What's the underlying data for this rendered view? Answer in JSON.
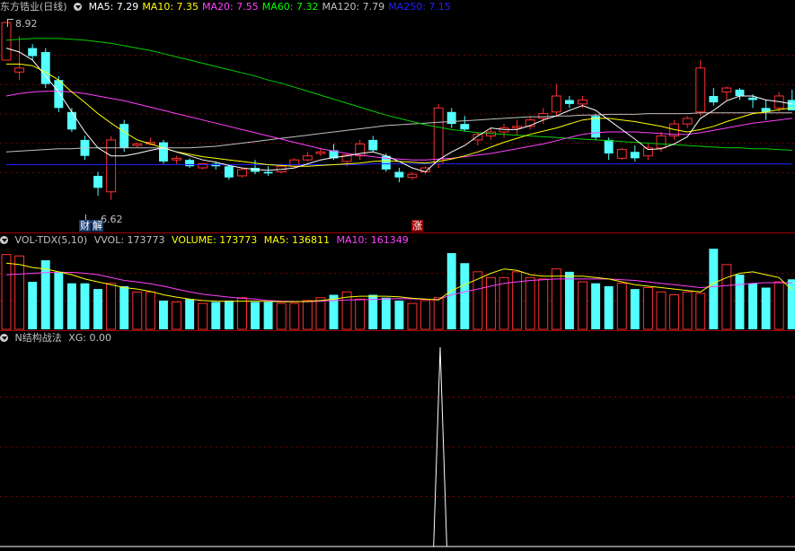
{
  "main": {
    "title": "东方锆业(日线)",
    "ma": [
      {
        "label": "MA5: 7.29",
        "color": "#ffffff"
      },
      {
        "label": "MA10: 7.35",
        "color": "#ffff00"
      },
      {
        "label": "MA20: 7.55",
        "color": "#ff40ff"
      },
      {
        "label": "MA60: 7.32",
        "color": "#00ff00"
      },
      {
        "label": "MA120: 7.79",
        "color": "#c0c0c0"
      },
      {
        "label": "MA250: 7.15",
        "color": "#2020ff"
      }
    ],
    "high_label": "8.92",
    "low_label": "6.62",
    "tag_finance": "财",
    "tag_explain": "解",
    "tag_limitup": "涨"
  },
  "volume": {
    "title": "VOL-TDX(5,10)",
    "vvol": "VVOL: 173773",
    "volume": "VOLUME: 173773",
    "ma5": "MA5: 136811",
    "ma10": "MA10: 161349"
  },
  "indicator": {
    "title": "N结构战法",
    "xg": "XG: 0.00"
  },
  "colors": {
    "up": "#ff3030",
    "down": "#54ffff",
    "grid": "#800000"
  },
  "chart_data": {
    "type": "candlestick",
    "ohlc": [
      [
        8.45,
        8.92,
        8.45,
        8.92
      ],
      [
        8.3,
        8.75,
        8.2,
        8.35
      ],
      [
        8.6,
        8.65,
        8.45,
        8.5
      ],
      [
        8.55,
        8.6,
        8.1,
        8.15
      ],
      [
        8.2,
        8.25,
        7.8,
        7.85
      ],
      [
        7.8,
        7.85,
        7.55,
        7.58
      ],
      [
        7.45,
        7.5,
        7.2,
        7.25
      ],
      [
        7.0,
        7.05,
        6.75,
        6.85
      ],
      [
        6.8,
        7.5,
        6.7,
        7.45
      ],
      [
        7.65,
        7.7,
        7.3,
        7.35
      ],
      [
        7.38,
        7.42,
        7.36,
        7.4
      ],
      [
        7.4,
        7.48,
        7.38,
        7.42
      ],
      [
        7.42,
        7.45,
        7.15,
        7.18
      ],
      [
        7.2,
        7.25,
        7.15,
        7.22
      ],
      [
        7.2,
        7.22,
        7.1,
        7.12
      ],
      [
        7.1,
        7.16,
        7.08,
        7.15
      ],
      [
        7.15,
        7.18,
        7.08,
        7.12
      ],
      [
        7.12,
        7.15,
        6.95,
        6.98
      ],
      [
        7.0,
        7.1,
        6.98,
        7.08
      ],
      [
        7.1,
        7.2,
        7.02,
        7.05
      ],
      [
        7.05,
        7.12,
        7.0,
        7.03
      ],
      [
        7.05,
        7.15,
        7.03,
        7.12
      ],
      [
        7.12,
        7.22,
        7.1,
        7.2
      ],
      [
        7.2,
        7.3,
        7.18,
        7.25
      ],
      [
        7.28,
        7.35,
        7.25,
        7.3
      ],
      [
        7.32,
        7.4,
        7.2,
        7.22
      ],
      [
        7.18,
        7.28,
        7.12,
        7.26
      ],
      [
        7.25,
        7.45,
        7.2,
        7.4
      ],
      [
        7.45,
        7.5,
        7.3,
        7.32
      ],
      [
        7.25,
        7.28,
        7.05,
        7.08
      ],
      [
        7.05,
        7.1,
        6.92,
        6.98
      ],
      [
        6.98,
        7.05,
        6.95,
        7.02
      ],
      [
        7.05,
        7.12,
        7.02,
        7.1
      ],
      [
        7.15,
        7.9,
        7.1,
        7.85
      ],
      [
        7.8,
        7.85,
        7.6,
        7.65
      ],
      [
        7.65,
        7.75,
        7.55,
        7.58
      ],
      [
        7.45,
        7.55,
        7.38,
        7.52
      ],
      [
        7.5,
        7.6,
        7.45,
        7.55
      ],
      [
        7.55,
        7.65,
        7.48,
        7.6
      ],
      [
        7.6,
        7.7,
        7.52,
        7.62
      ],
      [
        7.62,
        7.75,
        7.58,
        7.7
      ],
      [
        7.72,
        7.85,
        7.65,
        7.78
      ],
      [
        7.8,
        8.15,
        7.75,
        8.0
      ],
      [
        7.95,
        8.0,
        7.85,
        7.9
      ],
      [
        7.9,
        8.0,
        7.85,
        7.95
      ],
      [
        7.75,
        7.78,
        7.45,
        7.48
      ],
      [
        7.45,
        7.48,
        7.2,
        7.28
      ],
      [
        7.22,
        7.35,
        7.2,
        7.33
      ],
      [
        7.3,
        7.38,
        7.18,
        7.22
      ],
      [
        7.25,
        7.4,
        7.2,
        7.35
      ],
      [
        7.35,
        7.55,
        7.3,
        7.5
      ],
      [
        7.5,
        7.7,
        7.45,
        7.65
      ],
      [
        7.65,
        7.75,
        7.6,
        7.72
      ],
      [
        7.8,
        8.45,
        7.75,
        8.35
      ],
      [
        8.0,
        8.1,
        7.88,
        7.92
      ],
      [
        8.05,
        8.12,
        7.95,
        8.1
      ],
      [
        8.08,
        8.1,
        7.95,
        8.0
      ],
      [
        7.98,
        8.02,
        7.85,
        7.95
      ],
      [
        7.85,
        7.95,
        7.7,
        7.8
      ],
      [
        7.85,
        8.05,
        7.8,
        8.0
      ],
      [
        7.95,
        8.08,
        7.85,
        7.82
      ]
    ],
    "ma5": [
      8.6,
      8.55,
      8.45,
      8.25,
      8.05,
      7.8,
      7.55,
      7.35,
      7.25,
      7.25,
      7.28,
      7.32,
      7.35,
      7.3,
      7.25,
      7.2,
      7.17,
      7.13,
      7.1,
      7.08,
      7.07,
      7.08,
      7.1,
      7.15,
      7.2,
      7.23,
      7.25,
      7.28,
      7.3,
      7.25,
      7.18,
      7.1,
      7.05,
      7.2,
      7.3,
      7.38,
      7.5,
      7.6,
      7.58,
      7.58,
      7.63,
      7.7,
      7.75,
      7.82,
      7.88,
      7.82,
      7.7,
      7.58,
      7.46,
      7.33,
      7.34,
      7.4,
      7.49,
      7.72,
      7.82,
      7.94,
      8.0,
      8.0,
      7.95,
      7.93,
      7.9
    ],
    "ma10": [
      8.4,
      8.4,
      8.38,
      8.3,
      8.2,
      8.05,
      7.92,
      7.78,
      7.66,
      7.55,
      7.45,
      7.4,
      7.35,
      7.3,
      7.27,
      7.24,
      7.22,
      7.2,
      7.18,
      7.16,
      7.14,
      7.13,
      7.12,
      7.12,
      7.13,
      7.14,
      7.15,
      7.16,
      7.18,
      7.19,
      7.18,
      7.17,
      7.16,
      7.18,
      7.21,
      7.25,
      7.3,
      7.36,
      7.42,
      7.47,
      7.52,
      7.56,
      7.6,
      7.65,
      7.7,
      7.72,
      7.72,
      7.7,
      7.68,
      7.65,
      7.62,
      7.58,
      7.55,
      7.58,
      7.62,
      7.68,
      7.73,
      7.78,
      7.8,
      7.83,
      7.85
    ],
    "ma20": [
      8.0,
      8.03,
      8.05,
      8.06,
      8.06,
      8.05,
      8.03,
      8.0,
      7.97,
      7.94,
      7.9,
      7.86,
      7.82,
      7.78,
      7.74,
      7.7,
      7.66,
      7.62,
      7.58,
      7.54,
      7.5,
      7.46,
      7.42,
      7.38,
      7.34,
      7.31,
      7.28,
      7.26,
      7.24,
      7.22,
      7.21,
      7.2,
      7.2,
      7.21,
      7.22,
      7.24,
      7.26,
      7.28,
      7.31,
      7.34,
      7.37,
      7.4,
      7.44,
      7.48,
      7.52,
      7.54,
      7.55,
      7.55,
      7.55,
      7.54,
      7.53,
      7.52,
      7.52,
      7.54,
      7.57,
      7.6,
      7.63,
      7.66,
      7.68,
      7.7,
      7.72
    ],
    "ma60": [
      8.7,
      8.71,
      8.72,
      8.72,
      8.72,
      8.71,
      8.7,
      8.68,
      8.66,
      8.63,
      8.6,
      8.57,
      8.53,
      8.49,
      8.45,
      8.41,
      8.37,
      8.33,
      8.29,
      8.25,
      8.2,
      8.16,
      8.11,
      8.06,
      8.01,
      7.96,
      7.91,
      7.86,
      7.81,
      7.76,
      7.72,
      7.68,
      7.64,
      7.61,
      7.58,
      7.56,
      7.54,
      7.53,
      7.52,
      7.51,
      7.5,
      7.49,
      7.48,
      7.47,
      7.46,
      7.45,
      7.44,
      7.43,
      7.42,
      7.41,
      7.4,
      7.39,
      7.38,
      7.37,
      7.36,
      7.35,
      7.35,
      7.34,
      7.34,
      7.33,
      7.32
    ],
    "ma120": [
      7.3,
      7.31,
      7.32,
      7.33,
      7.34,
      7.34,
      7.35,
      7.35,
      7.35,
      7.35,
      7.35,
      7.35,
      7.35,
      7.35,
      7.35,
      7.36,
      7.37,
      7.39,
      7.41,
      7.43,
      7.45,
      7.47,
      7.49,
      7.51,
      7.53,
      7.55,
      7.57,
      7.59,
      7.61,
      7.63,
      7.64,
      7.65,
      7.66,
      7.67,
      7.68,
      7.69,
      7.7,
      7.71,
      7.72,
      7.73,
      7.74,
      7.74,
      7.75,
      7.75,
      7.76,
      7.76,
      7.77,
      7.77,
      7.77,
      7.78,
      7.78,
      7.78,
      7.78,
      7.79,
      7.79,
      7.79,
      7.79,
      7.79,
      7.79,
      7.79,
      7.79
    ],
    "ma250": [
      7.14,
      7.14,
      7.14,
      7.14,
      7.14,
      7.14,
      7.14,
      7.14,
      7.14,
      7.14,
      7.14,
      7.14,
      7.14,
      7.14,
      7.14,
      7.14,
      7.14,
      7.14,
      7.14,
      7.14,
      7.14,
      7.14,
      7.14,
      7.14,
      7.14,
      7.14,
      7.14,
      7.14,
      7.15,
      7.15,
      7.15,
      7.15,
      7.15,
      7.15,
      7.15,
      7.15,
      7.15,
      7.15,
      7.15,
      7.15,
      7.15,
      7.15,
      7.15,
      7.15,
      7.15,
      7.15,
      7.15,
      7.15,
      7.15,
      7.15,
      7.15,
      7.15,
      7.15,
      7.15,
      7.15,
      7.15,
      7.15,
      7.15,
      7.15,
      7.15,
      7.15
    ],
    "volume": [
      260000,
      255000,
      165000,
      240000,
      200000,
      160000,
      160000,
      140000,
      160000,
      150000,
      130000,
      130000,
      100000,
      95000,
      105000,
      90000,
      95000,
      100000,
      110000,
      95000,
      95000,
      90000,
      90000,
      100000,
      110000,
      120000,
      130000,
      105000,
      120000,
      110000,
      100000,
      90000,
      100000,
      110000,
      265000,
      230000,
      200000,
      180000,
      180000,
      200000,
      180000,
      175000,
      210000,
      200000,
      165000,
      160000,
      150000,
      160000,
      140000,
      145000,
      130000,
      120000,
      130000,
      125000,
      280000,
      225000,
      190000,
      160000,
      145000,
      165000,
      173773
    ],
    "vol_ma5": [
      230000,
      225000,
      215000,
      210000,
      200000,
      190000,
      175000,
      165000,
      155000,
      145000,
      140000,
      132000,
      120000,
      112000,
      105000,
      100000,
      98000,
      97000,
      98000,
      98000,
      97000,
      96000,
      96000,
      97000,
      100000,
      105000,
      112000,
      115000,
      115000,
      115000,
      113000,
      108000,
      105000,
      102000,
      135000,
      155000,
      175000,
      195000,
      210000,
      205000,
      190000,
      185000,
      185000,
      185000,
      185000,
      180000,
      175000,
      165000,
      155000,
      150000,
      145000,
      140000,
      135000,
      130000,
      160000,
      180000,
      195000,
      200000,
      190000,
      180000,
      136811
    ],
    "vol_ma10": [
      190000,
      192000,
      195000,
      197000,
      198000,
      198000,
      195000,
      190000,
      180000,
      170000,
      165000,
      158000,
      150000,
      140000,
      130000,
      122000,
      117000,
      112000,
      108000,
      105000,
      100000,
      98000,
      97000,
      96000,
      98000,
      100000,
      102000,
      103000,
      104000,
      106000,
      107000,
      106000,
      104000,
      104000,
      120000,
      130000,
      140000,
      150000,
      160000,
      165000,
      170000,
      172000,
      175000,
      175000,
      175000,
      175000,
      175000,
      172000,
      170000,
      165000,
      160000,
      155000,
      150000,
      145000,
      148000,
      152000,
      156000,
      160000,
      162000,
      162000,
      161349
    ],
    "xg": [
      0,
      0,
      0,
      0,
      0,
      0,
      0,
      0,
      0,
      0,
      0,
      0,
      0,
      0,
      0,
      0,
      0,
      0,
      0,
      0,
      0,
      0,
      0,
      0,
      0,
      0,
      0,
      0,
      0,
      0,
      0,
      0,
      0,
      0,
      0,
      0,
      0,
      0,
      0,
      0,
      0,
      0,
      0,
      0,
      0,
      0,
      0,
      0,
      0,
      0,
      0,
      0,
      0,
      0,
      0,
      0,
      0,
      0,
      0,
      0,
      0,
      0,
      0,
      0,
      0,
      0,
      0,
      1,
      0,
      0,
      0,
      0,
      0,
      0,
      0,
      0,
      0,
      0,
      0,
      0,
      0,
      0,
      0,
      0,
      0,
      0,
      0,
      0,
      0,
      0,
      0,
      0,
      0,
      0,
      0,
      0,
      0,
      0,
      0,
      0,
      0,
      0,
      0,
      0,
      0,
      0,
      0,
      0,
      0,
      0,
      0,
      0,
      0,
      0,
      0,
      0,
      0,
      0,
      0,
      0,
      0,
      0
    ]
  }
}
